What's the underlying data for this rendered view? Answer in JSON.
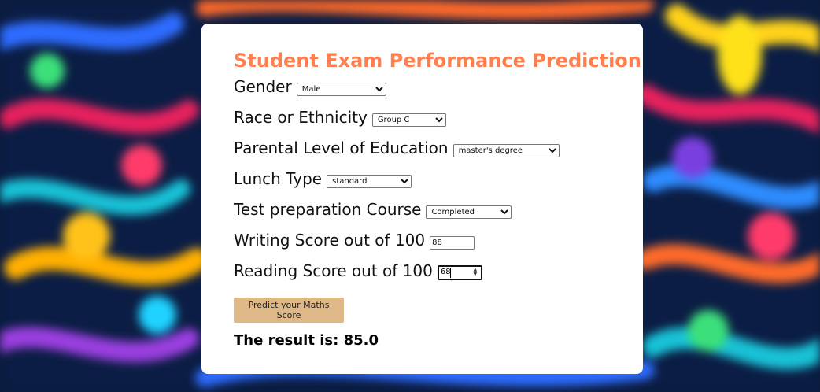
{
  "title": "Student Exam Performance Prediction",
  "form": {
    "gender": {
      "label": "Gender",
      "value": "Male"
    },
    "race": {
      "label": "Race or Ethnicity",
      "value": "Group C"
    },
    "parental": {
      "label": "Parental Level of Education",
      "value": "master's degree"
    },
    "lunch": {
      "label": "Lunch Type",
      "value": "standard"
    },
    "test_prep": {
      "label": "Test preparation Course",
      "value": "Completed"
    },
    "writing": {
      "label": "Writing Score out of 100",
      "value": "88"
    },
    "reading": {
      "label": "Reading Score out of 100",
      "value": "68"
    }
  },
  "button": {
    "label": "Predict your Maths Score"
  },
  "result": {
    "text": "The result is: 85.0"
  },
  "colors": {
    "title": "#ff7f50",
    "button": "#deb887"
  }
}
